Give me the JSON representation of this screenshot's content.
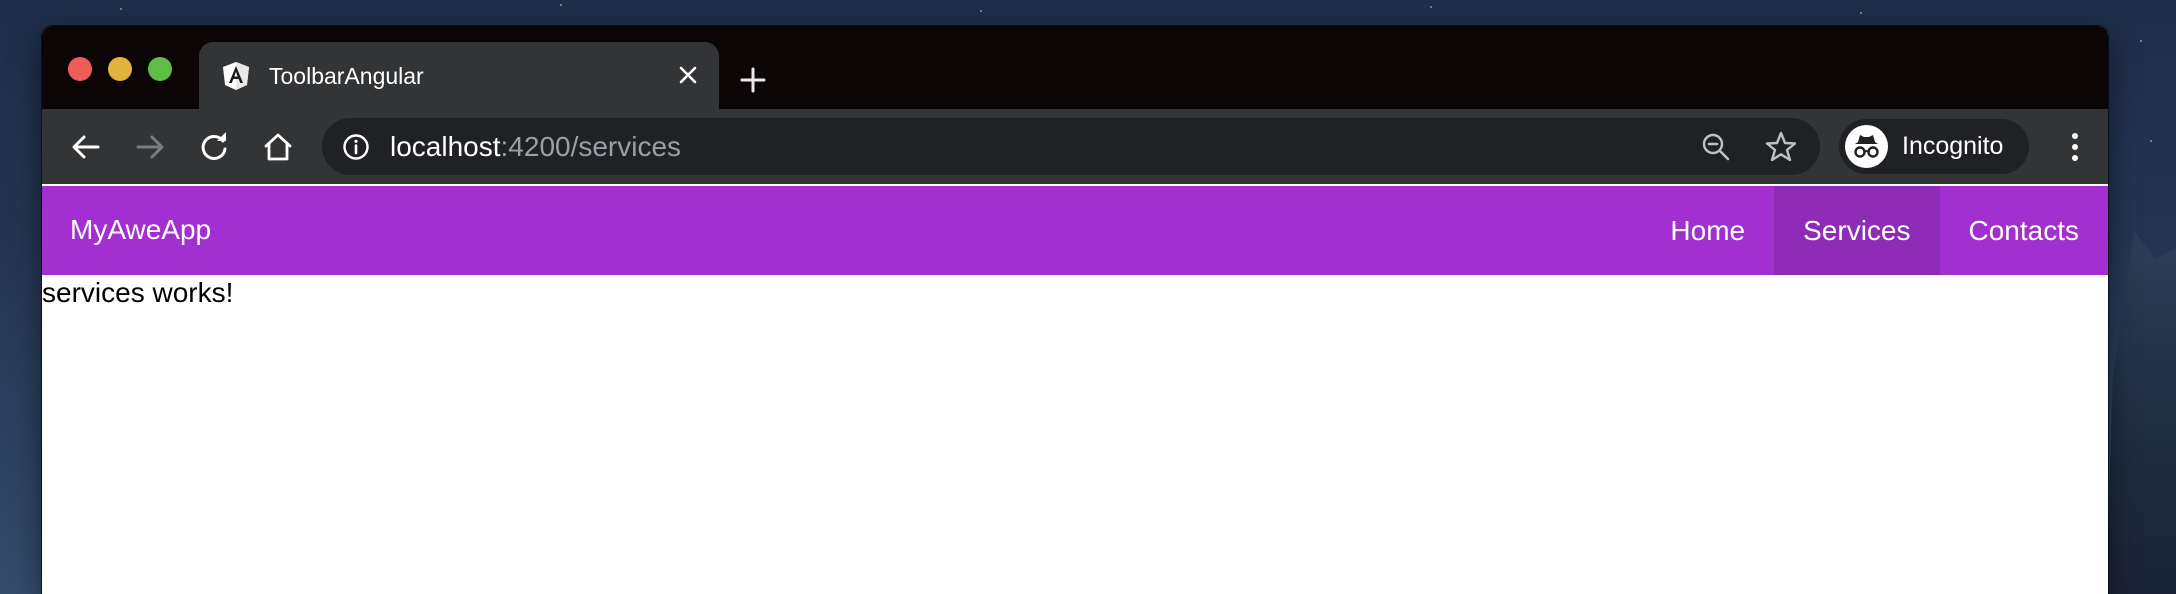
{
  "browser": {
    "tab": {
      "title": "ToolbarAngular",
      "favicon": "angular-icon"
    },
    "address_bar": {
      "host": "localhost",
      "path": ":4200/services"
    },
    "profile": {
      "label": "Incognito",
      "icon": "incognito-icon"
    },
    "icons": [
      "back-icon",
      "forward-icon",
      "reload-icon",
      "home-icon",
      "site-info-icon",
      "zoom-out-icon",
      "bookmark-star-icon",
      "more-menu-icon",
      "close-icon",
      "plus-icon"
    ]
  },
  "app": {
    "brand": "MyAweApp",
    "nav": [
      {
        "label": "Home",
        "active": false
      },
      {
        "label": "Services",
        "active": true
      },
      {
        "label": "Contacts",
        "active": false
      }
    ],
    "content_text": "services works!"
  },
  "colors": {
    "app_toolbar": "#a22fd0",
    "active_nav": "#8e2bb7",
    "browser_frame": "#333436",
    "omnibox": "#202124"
  }
}
